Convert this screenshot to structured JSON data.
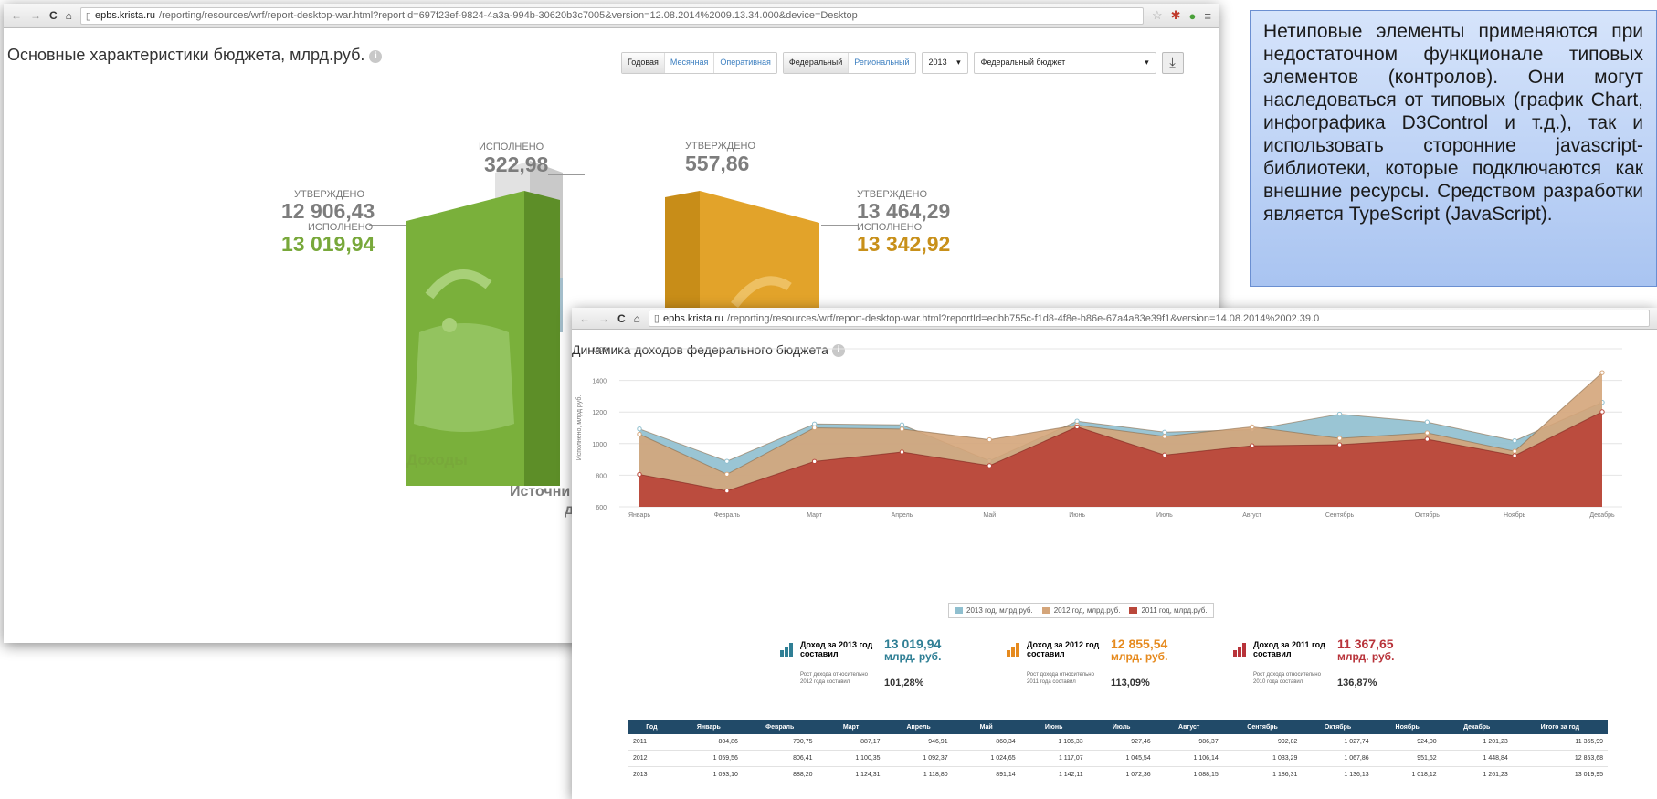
{
  "window1": {
    "url_host": "epbs.krista.ru",
    "url_rest": "/reporting/resources/wrf/report-desktop-war.html?reportId=697f23ef-9824-4a3a-994b-30620b3c7005&version=12.08.2014%2009.13.34.000&device=Desktop",
    "title": "Основные характеристики бюджета, млрд.руб.",
    "filters": {
      "period": [
        "Годовая",
        "Месячная",
        "Оперативная"
      ],
      "level": [
        "Федеральный",
        "Региональный"
      ],
      "year": "2013",
      "budget": "Федеральный бюджет"
    },
    "income": {
      "approved_label": "УТВЕРЖДЕНО",
      "approved": "12 906,43",
      "executed_label": "ИСПОЛНЕНО",
      "executed": "13 019,94",
      "caption": "Доходы"
    },
    "middle": {
      "executed_label": "ИСПОЛНЕНО",
      "executed": "322,98",
      "approved_label": "УТВЕРЖДЕНО",
      "approved": "557,86"
    },
    "expense": {
      "approved_label": "УТВЕРЖДЕНО",
      "approved": "13 464,29",
      "executed_label": "ИСПОЛНЕНО",
      "executed": "13 342,92"
    },
    "sources_caption_1": "Источни",
    "sources_caption_2": "деф"
  },
  "window2": {
    "url_host": "epbs.krista.ru",
    "url_rest": "/reporting/resources/wrf/report-desktop-war.html?reportId=edbb755c-f1d8-4f8e-b86e-67a4a83e39f1&version=14.08.2014%2002.39.0",
    "title": "Динамика доходов федерального бюджета",
    "summaries": [
      {
        "label": "Доход за 2013 год составил",
        "value": "13 019,94",
        "unit": "млрд. руб.",
        "growth_label": "Рост дохода относительно 2012 года составил",
        "growth": "101,28%"
      },
      {
        "label": "Доход за 2012 год составил",
        "value": "12 855,54",
        "unit": "млрд. руб.",
        "growth_label": "Рост дохода относительно 2011 года составил",
        "growth": "113,09%"
      },
      {
        "label": "Доход за 2011 год составил",
        "value": "11 367,65",
        "unit": "млрд. руб.",
        "growth_label": "Рост дохода относительно 2010 года составил",
        "growth": "136,87%"
      }
    ],
    "table": {
      "headers": [
        "Год",
        "Январь",
        "Февраль",
        "Март",
        "Апрель",
        "Май",
        "Июнь",
        "Июль",
        "Август",
        "Сентябрь",
        "Октябрь",
        "Ноябрь",
        "Декабрь",
        "Итого за год"
      ],
      "rows": [
        [
          "2011",
          "804,86",
          "700,75",
          "887,17",
          "946,91",
          "860,34",
          "1 106,33",
          "927,46",
          "986,37",
          "992,82",
          "1 027,74",
          "924,00",
          "1 201,23",
          "11 365,99"
        ],
        [
          "2012",
          "1 059,56",
          "806,41",
          "1 100,35",
          "1 092,37",
          "1 024,65",
          "1 117,07",
          "1 045,54",
          "1 106,14",
          "1 033,29",
          "1 067,86",
          "951,62",
          "1 448,84",
          "12 853,68"
        ],
        [
          "2013",
          "1 093,10",
          "888,20",
          "1 124,31",
          "1 118,80",
          "891,14",
          "1 142,11",
          "1 072,36",
          "1 088,15",
          "1 186,31",
          "1 136,13",
          "1 018,12",
          "1 261,23",
          "13 019,95"
        ]
      ]
    }
  },
  "chart_data": {
    "type": "area",
    "title": "Динамика доходов федерального бюджета",
    "ylabel": "Исполнено, млрд руб.",
    "ylim": [
      600,
      1600
    ],
    "yticks": [
      600,
      800,
      1000,
      1200,
      1400,
      1600
    ],
    "categories": [
      "Январь",
      "Февраль",
      "Март",
      "Апрель",
      "Май",
      "Июнь",
      "Июль",
      "Август",
      "Сентябрь",
      "Октябрь",
      "Ноябрь",
      "Декабрь"
    ],
    "series": [
      {
        "name": "2013 год, млрд.руб.",
        "color": "#8fbfcf",
        "values": [
          1093.1,
          888.2,
          1124.31,
          1118.8,
          891.14,
          1142.11,
          1072.36,
          1088.15,
          1186.31,
          1136.13,
          1018.12,
          1261.23
        ]
      },
      {
        "name": "2012 год, млрд.руб.",
        "color": "#d4a57a",
        "values": [
          1059.56,
          806.41,
          1100.35,
          1092.37,
          1024.65,
          1117.07,
          1045.54,
          1106.14,
          1033.29,
          1067.86,
          951.62,
          1448.84
        ]
      },
      {
        "name": "2011 год, млрд.руб.",
        "color": "#b9473a",
        "values": [
          804.86,
          700.75,
          887.17,
          946.91,
          860.34,
          1106.33,
          927.46,
          986.37,
          992.82,
          1027.74,
          924.0,
          1201.23
        ]
      }
    ],
    "grid": true,
    "legend": "bottom"
  },
  "callout_text": "Нетиповые элементы применяются при недостаточном функционале типовых элементов (контролов). Они могут наследоваться от типовых (график Chart, инфографика D3Control и т.д.), так и использовать сторонние javascript-библиотеки, которые подключаются как внешние ресурсы. Средством разработки является TypeScript (JavaScript)."
}
